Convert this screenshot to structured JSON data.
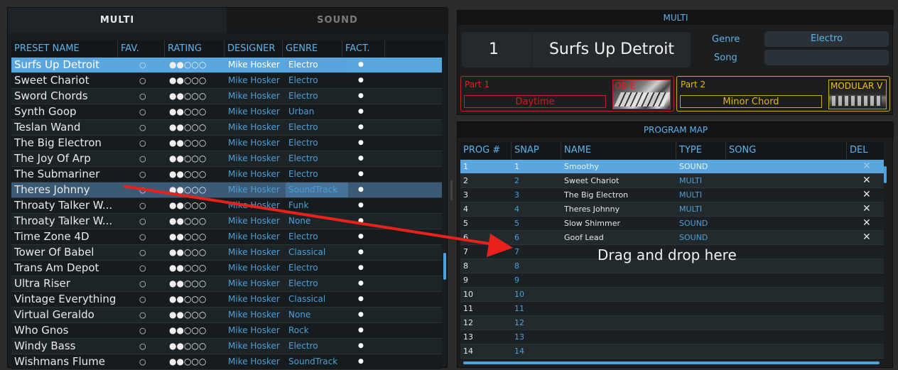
{
  "left_tabs": {
    "multi": "MULTI",
    "sound": "SOUND"
  },
  "preset_columns": [
    "PRESET NAME",
    "FAV.",
    "RATING",
    "DESIGNER",
    "GENRE",
    "FACT."
  ],
  "presets": [
    {
      "name": "Surfs Up Detroit",
      "fav": "○",
      "rating": "●●○○○",
      "designer": "Mike Hosker",
      "genre": "Electro",
      "fact": "●"
    },
    {
      "name": "Sweet Chariot",
      "fav": "○",
      "rating": "●●○○○",
      "designer": "Mike Hosker",
      "genre": "Electro",
      "fact": "●"
    },
    {
      "name": "Sword Chords",
      "fav": "○",
      "rating": "●●○○○",
      "designer": "Mike Hosker",
      "genre": "Electro",
      "fact": "●"
    },
    {
      "name": "Synth Goop",
      "fav": "○",
      "rating": "●●○○○",
      "designer": "Mike Hosker",
      "genre": "Urban",
      "fact": "●"
    },
    {
      "name": "Teslan Wand",
      "fav": "○",
      "rating": "●●○○○",
      "designer": "Mike Hosker",
      "genre": "Electro",
      "fact": "●"
    },
    {
      "name": "The Big Electron",
      "fav": "○",
      "rating": "●●○○○",
      "designer": "Mike Hosker",
      "genre": "Electro",
      "fact": "●"
    },
    {
      "name": "The Joy Of Arp",
      "fav": "○",
      "rating": "●●○○○",
      "designer": "Mike Hosker",
      "genre": "Electro",
      "fact": "●"
    },
    {
      "name": "The Submariner",
      "fav": "○",
      "rating": "●●○○○",
      "designer": "Mike Hosker",
      "genre": "Electro",
      "fact": "●"
    },
    {
      "name": "Theres Johnny",
      "fav": "○",
      "rating": "●●○○○",
      "designer": "Mike Hosker",
      "genre": "SoundTrack",
      "fact": "●"
    },
    {
      "name": "Throaty Talker W...",
      "fav": "○",
      "rating": "●●○○○",
      "designer": "Mike Hosker",
      "genre": "Funk",
      "fact": "●"
    },
    {
      "name": "Throaty Talker W...",
      "fav": "○",
      "rating": "●●○○○",
      "designer": "Mike Hosker",
      "genre": "None",
      "fact": "●"
    },
    {
      "name": "Time Zone 4D",
      "fav": "○",
      "rating": "●●○○○",
      "designer": "Mike Hosker",
      "genre": "Electro",
      "fact": "●"
    },
    {
      "name": "Tower Of Babel",
      "fav": "○",
      "rating": "●●○○○",
      "designer": "Mike Hosker",
      "genre": "Classical",
      "fact": "●"
    },
    {
      "name": "Trans Am Depot",
      "fav": "○",
      "rating": "●●○○○",
      "designer": "Mike Hosker",
      "genre": "Electro",
      "fact": "●"
    },
    {
      "name": "Ultra Riser",
      "fav": "○",
      "rating": "●●○○○",
      "designer": "Mike Hosker",
      "genre": "Electro",
      "fact": "●"
    },
    {
      "name": "Vintage Everything",
      "fav": "○",
      "rating": "●●○○○",
      "designer": "Mike Hosker",
      "genre": "Classical",
      "fact": "●"
    },
    {
      "name": "Virtual Geraldo",
      "fav": "○",
      "rating": "●●○○○",
      "designer": "Mike Hosker",
      "genre": "None",
      "fact": "●"
    },
    {
      "name": "Who Gnos",
      "fav": "○",
      "rating": "●●○○○",
      "designer": "Mike Hosker",
      "genre": "Rock",
      "fact": "●"
    },
    {
      "name": "Windy Bass",
      "fav": "○",
      "rating": "●●○○○",
      "designer": "Mike Hosker",
      "genre": "Electro",
      "fact": "●"
    },
    {
      "name": "Wishmans Flume",
      "fav": "○",
      "rating": "●●○○○",
      "designer": "Mike Hosker",
      "genre": "SoundTrack",
      "fact": "●"
    }
  ],
  "multi": {
    "title": "MULTI",
    "number": "1",
    "name": "Surfs Up Detroit",
    "genre_label": "Genre",
    "genre_value": "Electro",
    "song_label": "Song",
    "song_value": "",
    "part1": {
      "label": "Part 1",
      "sound": "Daytime",
      "thumb_label": "OB-E"
    },
    "part2": {
      "label": "Part 2",
      "sound": "Minor Chord",
      "thumb_label": "MODULAR V"
    }
  },
  "program_map": {
    "title": "PROGRAM MAP",
    "columns": [
      "PROG #",
      "SNAP",
      "NAME",
      "TYPE",
      "SONG",
      "DEL"
    ],
    "rows": [
      {
        "prog": "1",
        "snap": "1",
        "name": "Smoothy",
        "type": "SOUND",
        "del": "✕"
      },
      {
        "prog": "2",
        "snap": "2",
        "name": "Sweet Chariot",
        "type": "MULTI",
        "del": "✕"
      },
      {
        "prog": "3",
        "snap": "3",
        "name": "The Big Electron",
        "type": "MULTI",
        "del": "✕"
      },
      {
        "prog": "4",
        "snap": "4",
        "name": "Theres Johnny",
        "type": "MULTI",
        "del": "✕"
      },
      {
        "prog": "5",
        "snap": "5",
        "name": "Slow Shimmer",
        "type": "SOUND",
        "del": "✕"
      },
      {
        "prog": "6",
        "snap": "6",
        "name": "Goof Lead",
        "type": "SOUND",
        "del": "✕"
      },
      {
        "prog": "7",
        "snap": "7",
        "name": "",
        "type": "",
        "del": ""
      },
      {
        "prog": "8",
        "snap": "8",
        "name": "",
        "type": "",
        "del": ""
      },
      {
        "prog": "9",
        "snap": "9",
        "name": "",
        "type": "",
        "del": ""
      },
      {
        "prog": "10",
        "snap": "10",
        "name": "",
        "type": "",
        "del": ""
      },
      {
        "prog": "11",
        "snap": "11",
        "name": "",
        "type": "",
        "del": ""
      },
      {
        "prog": "12",
        "snap": "12",
        "name": "",
        "type": "",
        "del": ""
      },
      {
        "prog": "13",
        "snap": "13",
        "name": "",
        "type": "",
        "del": ""
      },
      {
        "prog": "14",
        "snap": "14",
        "name": "",
        "type": "",
        "del": ""
      }
    ],
    "drop_hint": "Drag and drop here"
  },
  "colors": {
    "accent": "#5aa7df",
    "part1": "#c8201d",
    "part2": "#d6a80f",
    "arrow": "#e8211b"
  }
}
